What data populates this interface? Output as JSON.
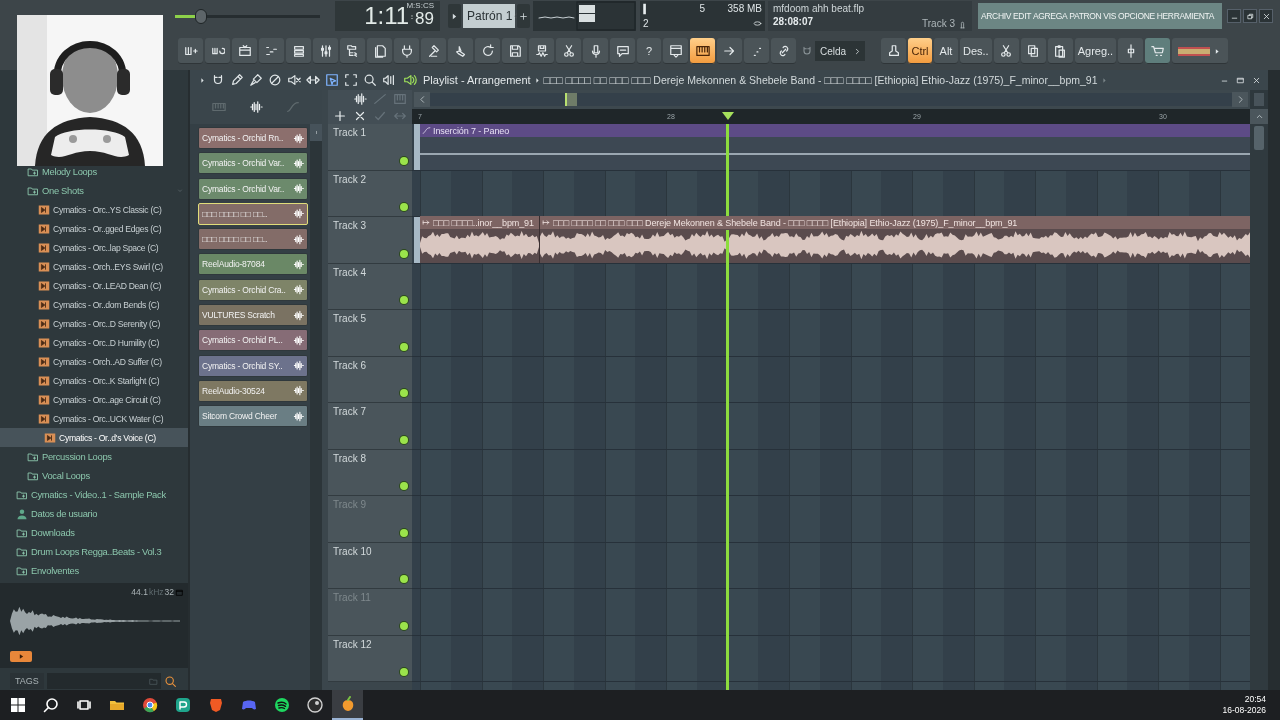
{
  "webcam": {
    "kind": "picture"
  },
  "transport": {
    "master_volume": {
      "level": 0.18
    },
    "time": "1:11",
    "time_fraction": "89",
    "time_unit": "M:S:CS",
    "pattern": "Patrón 1"
  },
  "monitor": {
    "cpu": "5",
    "memory": "358 MB",
    "polyphony": "2"
  },
  "project": {
    "file": "mfdoom ahh beat.flp",
    "time": "28:08:07",
    "hint": "Track 3"
  },
  "menu": [
    "ARCHIV",
    "EDIT",
    "AGREGA",
    "PATRON",
    "VIS",
    "OPCIONE",
    "HERRAMIENTA"
  ],
  "toolbar": [
    {
      "kind": "icon",
      "on": false
    },
    {
      "kind": "icon",
      "on": false
    },
    {
      "kind": "icon",
      "on": false
    },
    {
      "kind": "icon",
      "on": false
    },
    {
      "kind": "icon",
      "on": false
    },
    {
      "kind": "icon",
      "on": false
    },
    {
      "kind": "icon",
      "on": false
    },
    {
      "kind": "icon",
      "on": false
    },
    {
      "kind": "icon",
      "on": false
    },
    {
      "kind": "icon",
      "on": false
    },
    {
      "kind": "icon",
      "on": false
    },
    {
      "kind": "icon",
      "on": false
    },
    {
      "kind": "icon",
      "on": false
    },
    {
      "kind": "icon",
      "on": false
    },
    {
      "kind": "icon",
      "on": false
    },
    {
      "kind": "icon",
      "on": false
    },
    {
      "kind": "icon",
      "on": false
    },
    {
      "kind": "text",
      "label": "?",
      "on": false
    },
    {
      "kind": "icon",
      "on": false
    },
    {
      "kind": "icon",
      "on": true
    },
    {
      "kind": "icon",
      "on": false
    },
    {
      "kind": "icon",
      "on": false
    },
    {
      "kind": "icon",
      "on": false
    },
    {
      "kind": "dropdown",
      "label": "Celda"
    },
    {
      "kind": "icon",
      "on": false
    },
    {
      "kind": "text",
      "label": "Ctrl",
      "on": true
    },
    {
      "kind": "text",
      "label": "Alt",
      "on": false
    },
    {
      "kind": "text",
      "label": "Des..",
      "on": false
    },
    {
      "kind": "icon",
      "on": false
    },
    {
      "kind": "icon",
      "on": false
    },
    {
      "kind": "icon",
      "on": false
    },
    {
      "kind": "text",
      "label": "Agreg..",
      "on": false
    },
    {
      "kind": "icon",
      "on": false
    },
    {
      "kind": "icon",
      "on": false
    },
    {
      "kind": "swatch",
      "color": "#c9ad72"
    }
  ],
  "browser": {
    "tree": [
      {
        "children": [
          {
            "kind": "folder",
            "label": "Melody Loops"
          },
          {
            "kind": "folder",
            "label": "One Shots",
            "children": [
              {
                "kind": "sample",
                "label": "Cymatics - Orc..YS Classic (C)",
                "selected": false
              },
              {
                "kind": "sample",
                "label": "Cymatics - Or..gged Edges (C)",
                "selected": false
              },
              {
                "kind": "sample",
                "label": "Cymatics - Orc..lap Space (C)",
                "selected": false
              },
              {
                "kind": "sample",
                "label": "Cymatics - Orch..EYS Swirl (C)",
                "selected": false
              },
              {
                "kind": "sample",
                "label": "Cymatics - Or..LEAD Dean (C)",
                "selected": false
              },
              {
                "kind": "sample",
                "label": "Cymatics - Or..dom Bends (C)",
                "selected": false
              },
              {
                "kind": "sample",
                "label": "Cymatics - Orc..D Serenity (C)",
                "selected": false
              },
              {
                "kind": "sample",
                "label": "Cymatics - Orc..D Humility (C)",
                "selected": false
              },
              {
                "kind": "sample",
                "label": "Cymatics - Orch..AD Suffer (C)",
                "selected": false
              },
              {
                "kind": "sample",
                "label": "Cymatics - Orc..K Starlight (C)",
                "selected": false
              },
              {
                "kind": "sample",
                "label": "Cymatics - Orc..age Circuit (C)",
                "selected": false
              },
              {
                "kind": "sample",
                "label": "Cymatics - Orc..UCK Water (C)",
                "selected": false
              },
              {
                "kind": "sample",
                "label": "Cymatics - Or..d's Voice (C)",
                "selected": true
              }
            ]
          },
          {
            "kind": "folder",
            "label": "Percussion Loops"
          },
          {
            "kind": "folder",
            "label": "Vocal Loops"
          }
        ]
      },
      {
        "kind": "folder",
        "label": "Cymatics - Video..1 - Sample Pack"
      },
      {
        "kind": "user",
        "label": "Datos de usuario"
      },
      {
        "kind": "folder",
        "label": "Downloads"
      },
      {
        "kind": "folder",
        "label": "Drum Loops Regga..Beats - Vol.3"
      },
      {
        "kind": "folder",
        "label": "Envolventes"
      }
    ],
    "preview": {
      "rate": "44.1",
      "unit": "kHz",
      "bits": "32"
    },
    "tags_label": "TAGS"
  },
  "playlist": {
    "title": "Playlist - Arrangement",
    "song": "□□□ □□□□ □□ □□□ □□□ Dereje Mekonnen & Shebele Band - □□□ □□□□ [Ethiopia] Ethio-Jazz (1975)_F_minor__bpm_91",
    "tools": [
      {
        "selected": false
      },
      {
        "selected": false
      },
      {
        "selected": false
      },
      {
        "selected": false
      },
      {
        "selected": false
      },
      {
        "selected": false
      },
      {
        "selected": true
      },
      {
        "selected": false
      },
      {
        "selected": false
      },
      {
        "selected": false
      }
    ],
    "clips": [
      {
        "name": "Cymatics - Orchid Rn..",
        "color": "#8c6f6d",
        "selected": false
      },
      {
        "name": "Cymatics - Orchid Var..",
        "color": "#6c8a6c",
        "selected": false
      },
      {
        "name": "Cymatics - Orchid Var..",
        "color": "#6c8a6c",
        "selected": false
      },
      {
        "name": "□□□ □□□□ □□ □□..",
        "color": "#836c68",
        "selected": true
      },
      {
        "name": "□□□ □□□□ □□ □□..",
        "color": "#836c68",
        "selected": false
      },
      {
        "name": "ReelAudio-87084",
        "color": "#6a8866",
        "selected": false
      },
      {
        "name": "Cymatics - Orchid Cra..",
        "color": "#7e8468",
        "selected": false
      },
      {
        "name": "VULTURES Scratch",
        "color": "#7a7262",
        "selected": false
      },
      {
        "name": "Cymatics - Orchid PL..",
        "color": "#866c76",
        "selected": false
      },
      {
        "name": "Cymatics - Orchid SY..",
        "color": "#6c728c",
        "selected": false
      },
      {
        "name": "ReelAudio-30524",
        "color": "#7e7862",
        "selected": false
      },
      {
        "name": "Sitcom Crowd Cheer",
        "color": "#6a7e84",
        "selected": false
      }
    ],
    "ruler": [
      "7",
      "28",
      "29",
      "30"
    ],
    "playhead": {
      "level": 0.377
    },
    "tracks": [
      {
        "name": "Track 1",
        "disabled": false,
        "clips": [
          {
            "kind": "automation",
            "label": "Inserción 7 - Paneo"
          }
        ]
      },
      {
        "name": "Track 2",
        "disabled": false
      },
      {
        "name": "Track 3",
        "disabled": false,
        "clips": [
          {
            "kind": "audio",
            "label": "□□□ □□□□..inor__bpm_91"
          },
          {
            "kind": "audio",
            "label": "□□□ □□□□ □□ □□□ □□□ Dereje Mekonnen & Shebele Band - □□□ □□□□ [Ethiopia] Ethio-Jazz (1975)_F_minor__bpm_91"
          }
        ]
      },
      {
        "name": "Track 4",
        "disabled": false
      },
      {
        "name": "Track 5",
        "disabled": false
      },
      {
        "name": "Track 6",
        "disabled": false
      },
      {
        "name": "Track 7",
        "disabled": false
      },
      {
        "name": "Track 8",
        "disabled": false
      },
      {
        "name": "Track 9",
        "disabled": true
      },
      {
        "name": "Track 10",
        "disabled": false
      },
      {
        "name": "Track 11",
        "disabled": true
      },
      {
        "name": "Track 12",
        "disabled": false
      }
    ]
  },
  "taskbar": {
    "apps": [
      {
        "selected": false
      },
      {
        "selected": false
      },
      {
        "selected": false
      },
      {
        "selected": false
      },
      {
        "selected": false
      },
      {
        "selected": false
      },
      {
        "selected": false
      },
      {
        "selected": true
      }
    ],
    "time": "20:54",
    "date": "16-08-2026"
  }
}
